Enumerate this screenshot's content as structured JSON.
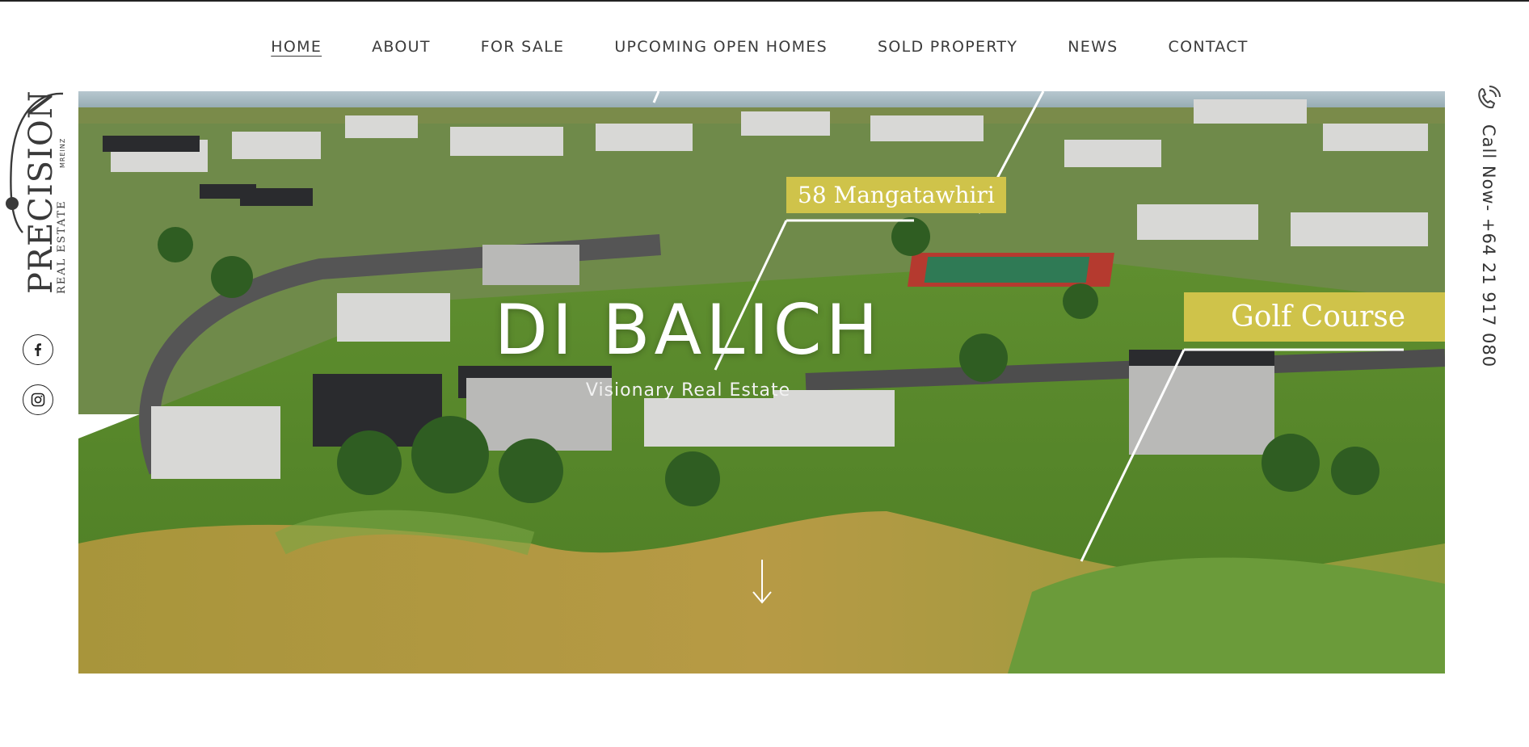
{
  "nav": {
    "items": [
      {
        "label": "HOME",
        "active": true
      },
      {
        "label": "ABOUT"
      },
      {
        "label": "FOR SALE"
      },
      {
        "label": "UPCOMING OPEN HOMES"
      },
      {
        "label": "SOLD PROPERTY"
      },
      {
        "label": "NEWS"
      },
      {
        "label": "CONTACT"
      }
    ]
  },
  "brand": {
    "logo_text": "PRECISION",
    "logo_sub": "REAL ESTATE",
    "logo_mark": "MREINZ"
  },
  "social": {
    "facebook_icon": "facebook-icon",
    "instagram_icon": "instagram-icon"
  },
  "contact": {
    "call_label": "Call Now-  +64 21 917 080",
    "phone_icon": "phone-icon"
  },
  "hero": {
    "title": "DI BALICH",
    "subtitle": "Visionary Real Estate",
    "labels": [
      "58 Mangatawhiri",
      "Golf Course"
    ],
    "scroll_icon": "arrow-down-icon"
  },
  "colors": {
    "accent": "#cfc34a",
    "text": "#3b3b3b"
  }
}
